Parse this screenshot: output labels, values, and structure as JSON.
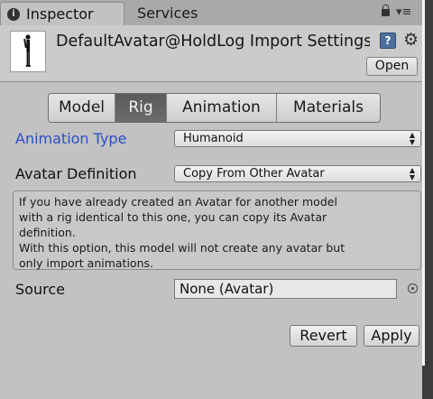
{
  "window": {
    "tabs": [
      {
        "label": "Inspector",
        "icon": "info-icon",
        "active": true
      },
      {
        "label": "Services",
        "active": false
      }
    ]
  },
  "header": {
    "title": "DefaultAvatar@HoldLog Import Settings",
    "open_label": "Open",
    "help_icon": "help-book-icon",
    "settings_icon": "gear-icon"
  },
  "rig_tabs": [
    {
      "label": "Model",
      "selected": false
    },
    {
      "label": "Rig",
      "selected": true
    },
    {
      "label": "Animation",
      "selected": false
    },
    {
      "label": "Materials",
      "selected": false
    }
  ],
  "fields": {
    "animation_type": {
      "label": "Animation Type",
      "value": "Humanoid"
    },
    "avatar_definition": {
      "label": "Avatar Definition",
      "value": "Copy From Other Avatar"
    },
    "help_lines": [
      "If you have already created an Avatar for another model",
      "with a rig identical to this one, you can copy its Avatar",
      "definition.",
      "With this option, this model will not create any avatar but",
      "only import animations."
    ],
    "source": {
      "label": "Source",
      "value": "None (Avatar)"
    }
  },
  "buttons": {
    "revert": "Revert",
    "apply": "Apply"
  },
  "colors": {
    "panel": "#c2c2c2",
    "highlight_label": "#2b4fc4",
    "selected_tab": "#5f5f5f"
  }
}
